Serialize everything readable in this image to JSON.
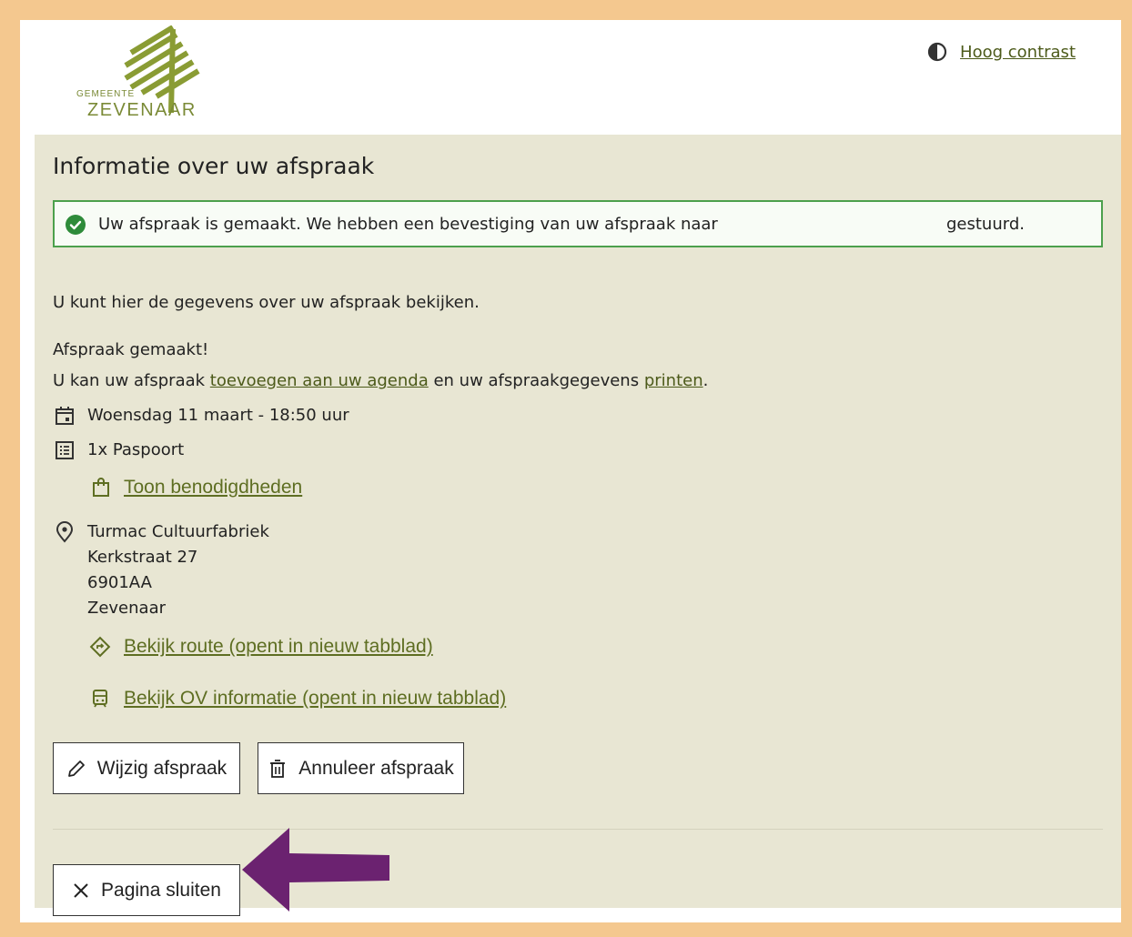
{
  "header": {
    "logo_small": "GEMEENTE",
    "logo_large": "ZEVENAAR",
    "contrast_label": "Hoog contrast",
    "contrast_icon": "half-circle-icon"
  },
  "page": {
    "title": "Informatie over uw afspraak",
    "alert_text": "Uw afspraak is gemaakt. We hebben een bevestiging van uw afspraak naar",
    "alert_text_end": "gestuurd.",
    "intro": "U kunt hier de gegevens over uw afspraak bekijken.",
    "made": "Afspraak gemaakt!",
    "agenda_pre": "U kan uw afspraak ",
    "agenda_link": "toevoegen aan uw agenda",
    "agenda_mid": " en uw afspraakgegevens ",
    "print_link": "printen",
    "agenda_post": "."
  },
  "appointment": {
    "datetime": "Woensdag 11 maart - 18:50 uur",
    "product": "1x Paspoort",
    "requirements_link": "Toon benodigdheden",
    "location_name": "Turmac Cultuurfabriek",
    "street": "Kerkstraat 27",
    "postcode": "6901AA",
    "city": "Zevenaar",
    "route_link": "Bekijk route (opent in nieuw tabblad)",
    "ov_link": "Bekijk OV informatie (opent in nieuw tabblad)"
  },
  "actions": {
    "edit": "Wijzig afspraak",
    "cancel": "Annuleer afspraak",
    "close": "Pagina sluiten"
  },
  "colors": {
    "accent": "#4c5a1a",
    "success": "#2e8b3a",
    "panel": "#e8e6d3",
    "annotation_arrow": "#6b2270",
    "page_border": "#f4c88f"
  }
}
